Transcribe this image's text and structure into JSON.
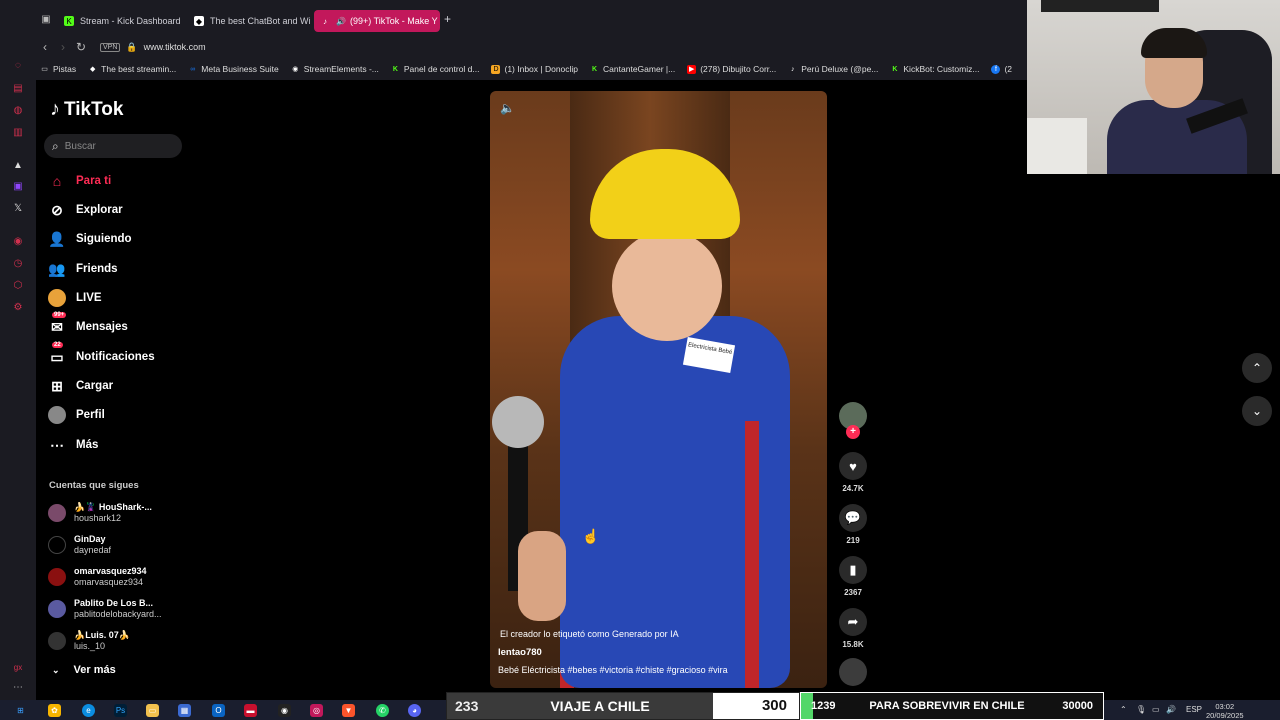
{
  "browser": {
    "tabs": [
      {
        "label": "Stream - Kick Dashboard",
        "favicon": "kick-icon",
        "color": "#53fc18"
      },
      {
        "label": "The best ChatBot and Wi",
        "favicon": "streamelements-icon",
        "color": "#ffffff"
      },
      {
        "label": "(99+) TikTok - Make Y",
        "favicon": "tiktok-icon",
        "color": "#ffffff"
      }
    ],
    "url": "www.tiktok.com",
    "vpn_label": "VPN",
    "bookmarks": [
      {
        "label": "Pistas",
        "icon": "folder-icon"
      },
      {
        "label": "The best streamin...",
        "icon": "streamelements-icon"
      },
      {
        "label": "Meta Business Suite",
        "icon": "meta-icon"
      },
      {
        "label": "StreamElements -...",
        "icon": "streamelements-icon"
      },
      {
        "label": "Panel de control d...",
        "icon": "kick-icon"
      },
      {
        "label": "(1) Inbox | Donoclip",
        "icon": "donoclip-icon"
      },
      {
        "label": "CantanteGamer |...",
        "icon": "kick-icon"
      },
      {
        "label": "(278) Dibujito Corr...",
        "icon": "youtube-icon"
      },
      {
        "label": "Perú Deluxe (@pe...",
        "icon": "tiktok-icon"
      },
      {
        "label": "KickBot: Customiz...",
        "icon": "kick-icon"
      },
      {
        "label": "(2",
        "icon": "facebook-icon"
      }
    ]
  },
  "tiktok": {
    "logo": "TikTok",
    "search_placeholder": "Buscar",
    "nav": [
      {
        "label": "Para ti",
        "icon": "home-icon",
        "active": true
      },
      {
        "label": "Explorar",
        "icon": "compass-icon"
      },
      {
        "label": "Siguiendo",
        "icon": "following-icon"
      },
      {
        "label": "Friends",
        "icon": "friends-icon"
      },
      {
        "label": "LIVE",
        "icon": "live-icon"
      },
      {
        "label": "Mensajes",
        "icon": "messages-icon",
        "badge": "99+"
      },
      {
        "label": "Notificaciones",
        "icon": "inbox-icon",
        "badge": "22"
      },
      {
        "label": "Cargar",
        "icon": "upload-icon"
      },
      {
        "label": "Perfil",
        "icon": "profile-icon"
      },
      {
        "label": "Más",
        "icon": "more-icon"
      }
    ],
    "following_title": "Cuentas que sigues",
    "accounts": [
      {
        "name": "🍌🦹 HouShark-...",
        "user": "houshark12",
        "avatar_color": "#7a4a6a"
      },
      {
        "name": "GinDay",
        "user": "daynedaf",
        "avatar_color": "#000000"
      },
      {
        "name": "omarvasquez934",
        "user": "omarvasquez934",
        "avatar_color": "#8a1010"
      },
      {
        "name": "Pablito De Los B...",
        "user": "pablitodelobackyard...",
        "avatar_color": "#5a5aa0"
      },
      {
        "name": "🍌Luis. 07🍌",
        "user": "luis._10",
        "avatar_color": "#333333"
      }
    ],
    "see_more": "Ver más",
    "video": {
      "ai_label": "El creador lo etiquetó como Generado por IA",
      "username": "lentao780",
      "description": "Bebé Eléctricista #bebes #victoria #chiste #gracioso #vira",
      "tag_text": "Electricista Bebé"
    },
    "actions": {
      "likes": "24.7K",
      "comments": "219",
      "saves": "2367",
      "shares": "15.8K"
    }
  },
  "goals": {
    "goal1": {
      "current": "233",
      "label": "VIAJE A CHILE",
      "target": "300",
      "progress": 0.78
    },
    "goal2": {
      "current": "1239",
      "label": "PARA SOBREVIVIR EN CHILE",
      "target": "30000",
      "progress": 0.04
    }
  },
  "taskbar": {
    "lang": "ESP",
    "time": "03:02",
    "date": "20/09/2025"
  },
  "colors": {
    "accent": "#fe2c55",
    "kick_green": "#53fc18",
    "active_tab": "#c2185b"
  }
}
